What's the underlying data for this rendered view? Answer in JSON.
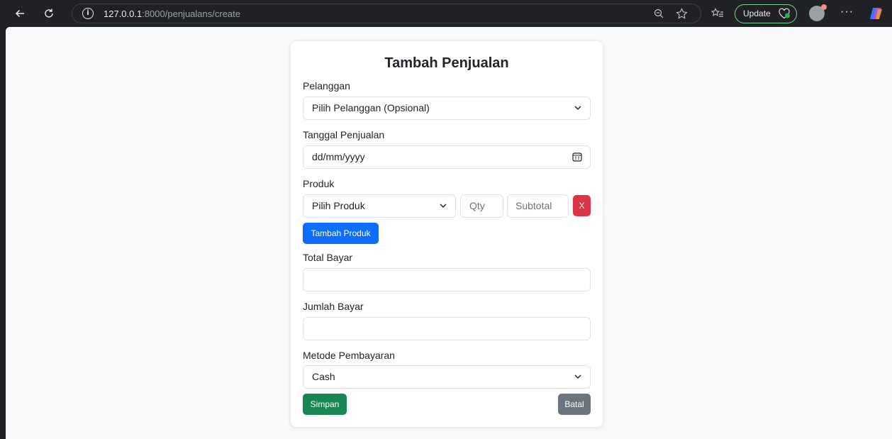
{
  "browser": {
    "url_host": "127.0.0.1",
    "url_rest": ":8000/penjualans/create",
    "update_label": "Update",
    "more_label": "···"
  },
  "form": {
    "title": "Tambah Penjualan",
    "pelanggan": {
      "label": "Pelanggan",
      "value": "Pilih Pelanggan (Opsional)"
    },
    "tanggal": {
      "label": "Tanggal Penjualan",
      "value": "dd/mm/yyyy"
    },
    "produk": {
      "label": "Produk",
      "select_value": "Pilih Produk",
      "qty_placeholder": "Qty",
      "subtotal_placeholder": "Subtotal",
      "remove_label": "X",
      "add_label": "Tambah Produk"
    },
    "total_bayar": {
      "label": "Total Bayar",
      "value": ""
    },
    "jumlah_bayar": {
      "label": "Jumlah Bayar",
      "value": ""
    },
    "metode": {
      "label": "Metode Pembayaran",
      "value": "Cash"
    },
    "save_label": "Simpan",
    "cancel_label": "Batal"
  }
}
